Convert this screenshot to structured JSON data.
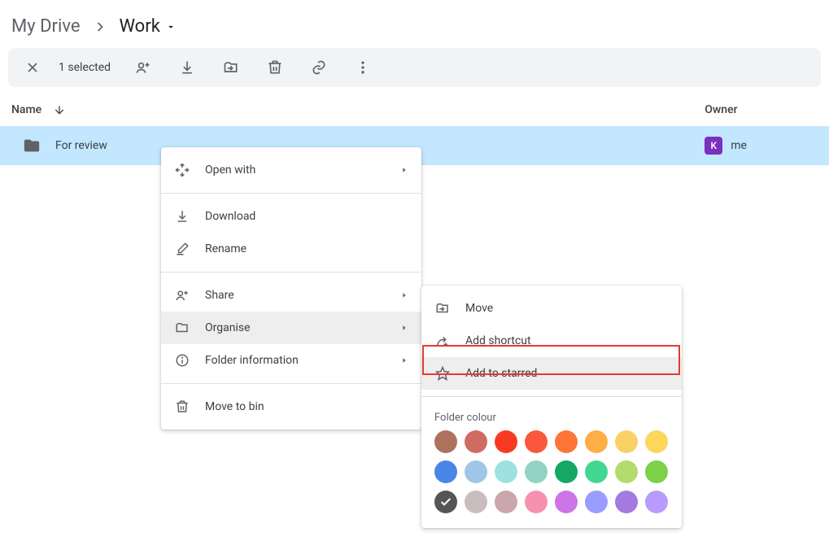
{
  "breadcrumb": {
    "root": "My Drive",
    "current": "Work"
  },
  "action_bar": {
    "selected_text": "1 selected"
  },
  "columns": {
    "name": "Name",
    "owner": "Owner"
  },
  "row": {
    "name": "For review",
    "owner": "me",
    "avatar_initial": "K"
  },
  "menu": {
    "open_with": "Open with",
    "download": "Download",
    "rename": "Rename",
    "share": "Share",
    "organise": "Organise",
    "folder_info": "Folder information",
    "move_to_bin": "Move to bin"
  },
  "submenu": {
    "move": "Move",
    "add_shortcut": "Add shortcut",
    "add_to_starred": "Add to starred",
    "folder_colour": "Folder colour"
  },
  "colors": [
    "#ac725e",
    "#d06b64",
    "#f83a22",
    "#fa573c",
    "#ff7537",
    "#ffad46",
    "#fad165",
    "#fbd75b",
    "#4986e7",
    "#9fc6e7",
    "#9de1e0",
    "#92d2c3",
    "#16a765",
    "#42d692",
    "#b3dc6c",
    "#7bd148",
    "#555555",
    "#cabdbf",
    "#cca6ac",
    "#f691b2",
    "#cd74e6",
    "#9a9cff",
    "#a47ae2",
    "#b99aff"
  ],
  "selected_color_index": 16
}
